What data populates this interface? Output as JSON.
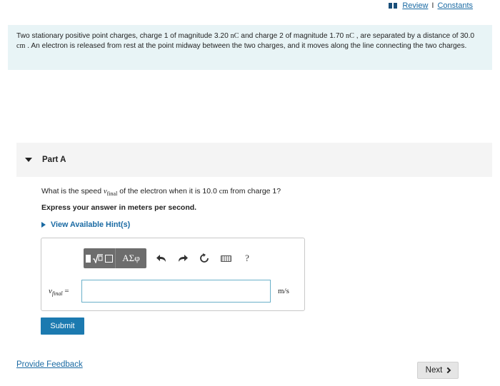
{
  "header": {
    "review_label": "Review",
    "separator": "I",
    "constants_label": "Constants"
  },
  "problem": {
    "text_1": "Two stationary positive point charges, charge 1 of magnitude 3.20 ",
    "unit_nc_1": "nC",
    "text_2": " and charge 2 of magnitude 1.70 ",
    "unit_nc_2": "nC",
    "text_3": " , are separated by a distance of 30.0 ",
    "unit_cm": "cm",
    "text_4": " . An electron is released from rest at the point midway between the two charges, and it moves along the line connecting the two charges."
  },
  "part": {
    "title": "Part A",
    "question_1": "What is the speed ",
    "question_var": "v",
    "question_sub": "final",
    "question_2": " of the electron when it is 10.0 ",
    "question_unit": "cm",
    "question_3": " from charge 1?",
    "express": "Express your answer in meters per second.",
    "hint_label": "View Available Hint(s)"
  },
  "toolbar": {
    "greek_label": "ΑΣφ",
    "help_label": "?"
  },
  "answer": {
    "var": "v",
    "var_sub": "final",
    "equals": "=",
    "value": "",
    "unit": "m/s"
  },
  "actions": {
    "submit_label": "Submit",
    "feedback_label": "Provide Feedback",
    "next_label": "Next"
  }
}
